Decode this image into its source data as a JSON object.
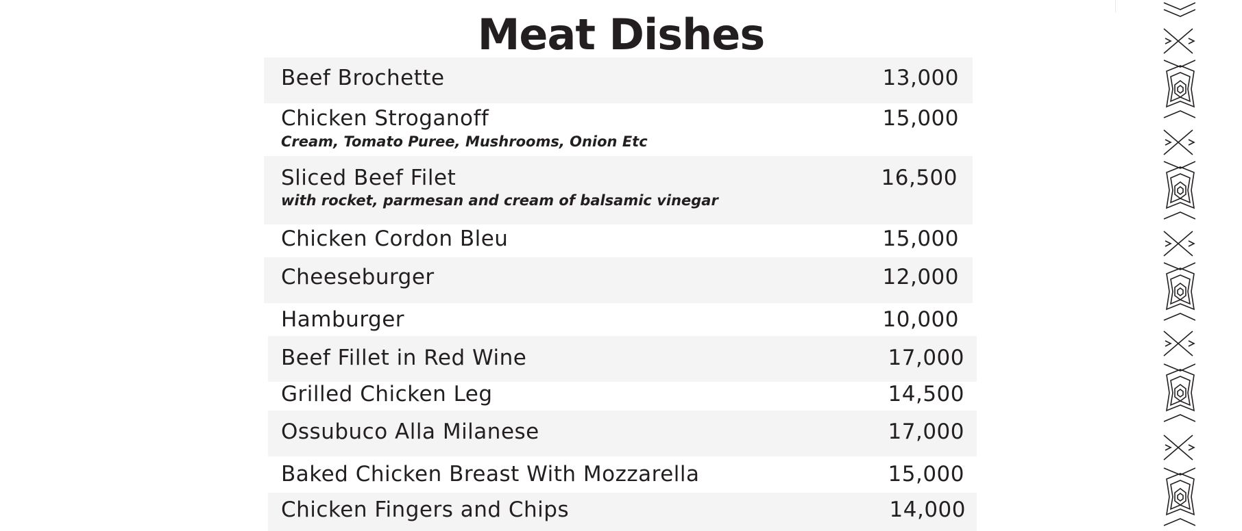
{
  "menu": {
    "title": "Meat Dishes",
    "items": [
      {
        "name": "Beef Brochette",
        "description": "",
        "price": "13,000"
      },
      {
        "name": "Chicken Stroganoff",
        "description": "Cream, Tomato Puree, Mushrooms, Onion Etc",
        "price": "15,000"
      },
      {
        "name": "Sliced Beef Filet",
        "description": "with rocket, parmesan and cream of balsamic vinegar",
        "price": "16,500"
      },
      {
        "name": "Chicken Cordon Bleu",
        "description": "",
        "price": "15,000"
      },
      {
        "name": "Cheeseburger",
        "description": "",
        "price": "12,000"
      },
      {
        "name": "Hamburger",
        "description": "",
        "price": "10,000"
      },
      {
        "name": "Beef Fillet in Red Wine",
        "description": "",
        "price": "17,000"
      },
      {
        "name": "Grilled Chicken Leg",
        "description": "",
        "price": "14,500"
      },
      {
        "name": "Ossubuco Alla Milanese",
        "description": "",
        "price": "17,000"
      },
      {
        "name": "Baked Chicken Breast With Mozzarella",
        "description": "",
        "price": "15,000"
      },
      {
        "name": "Chicken Fingers and Chips",
        "description": "",
        "price": "14,000"
      }
    ]
  },
  "decor": {
    "border_icon": "tribal-border-pattern-icon"
  }
}
